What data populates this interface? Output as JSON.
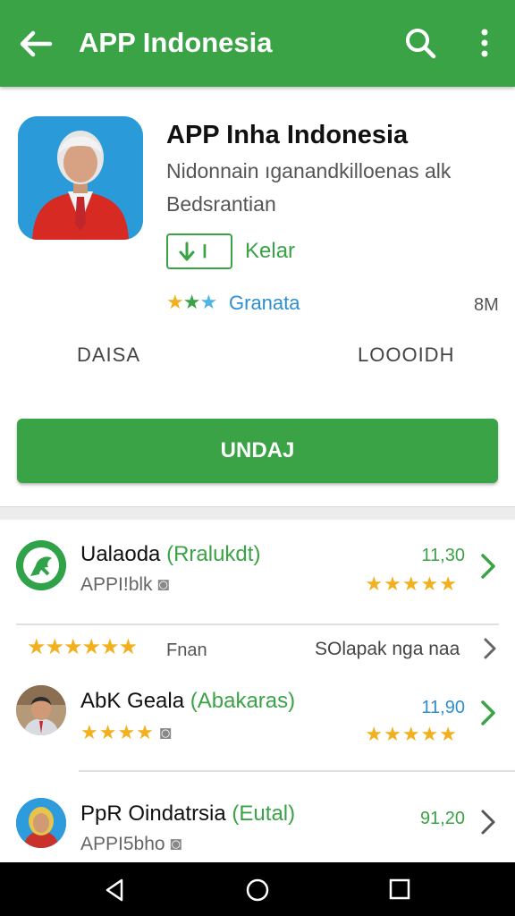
{
  "appbar": {
    "title": "APP Indonesia",
    "back_icon": "arrow-left-icon",
    "search_icon": "search-icon",
    "more_icon": "more-vert-icon",
    "color": "#3aa346"
  },
  "app": {
    "name": "APP Inha Indonesia",
    "desc_line1": "Nidonnain ıganandkilloenas alk",
    "desc_line2": "Bedsrantian",
    "badge_text": "Ⅰ",
    "badge_label": "Kelar",
    "rating_stars": "★★★",
    "rating_label": "Granata",
    "size": "8M",
    "stat_left": "DAISA",
    "stat_right": "LOOOIDH",
    "install_label": "UNDAJ"
  },
  "list": [
    {
      "name": "Ualaoda",
      "tag": "(Rralukdt)",
      "sub": "APPI!blk",
      "price": "11,30",
      "stars": "★★★★★"
    },
    {
      "header_stars": "★★★★★★",
      "header_label": "Fnan",
      "header_link": "SOlapak nga naa"
    },
    {
      "name": "AbK Geala",
      "tag": "(Abakaras)",
      "sub_stars": "★★★★",
      "price": "11,90",
      "stars": "★★★★★"
    },
    {
      "name": "PpR Oindatrsia",
      "tag": "(Eutal)",
      "sub": "APPI5bho",
      "price": "91,20"
    }
  ]
}
